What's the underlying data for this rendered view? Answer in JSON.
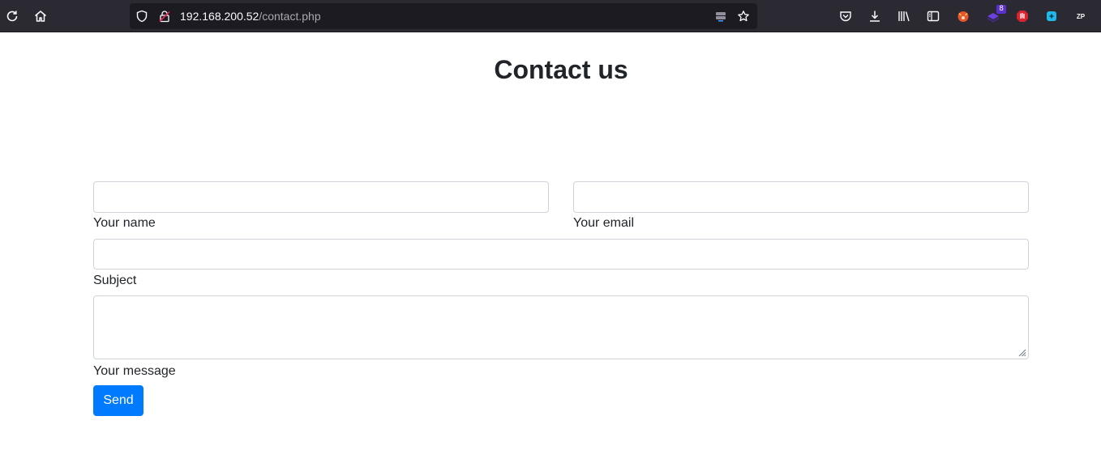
{
  "browser": {
    "url_host": "192.168.200.52",
    "url_path": "/contact.php",
    "extension_badge": "8",
    "extension_label": "ZP"
  },
  "page": {
    "title": "Contact us"
  },
  "form": {
    "name_label": "Your name",
    "name_value": "",
    "email_label": "Your email",
    "email_value": "",
    "subject_label": "Subject",
    "subject_value": "",
    "message_label": "Your message",
    "message_value": "",
    "send_label": "Send"
  },
  "colors": {
    "toolbar_bg": "#2b2a33",
    "url_bg": "#1c1b22",
    "button_primary": "#007bff",
    "text": "#212529",
    "border": "#ced4da"
  }
}
